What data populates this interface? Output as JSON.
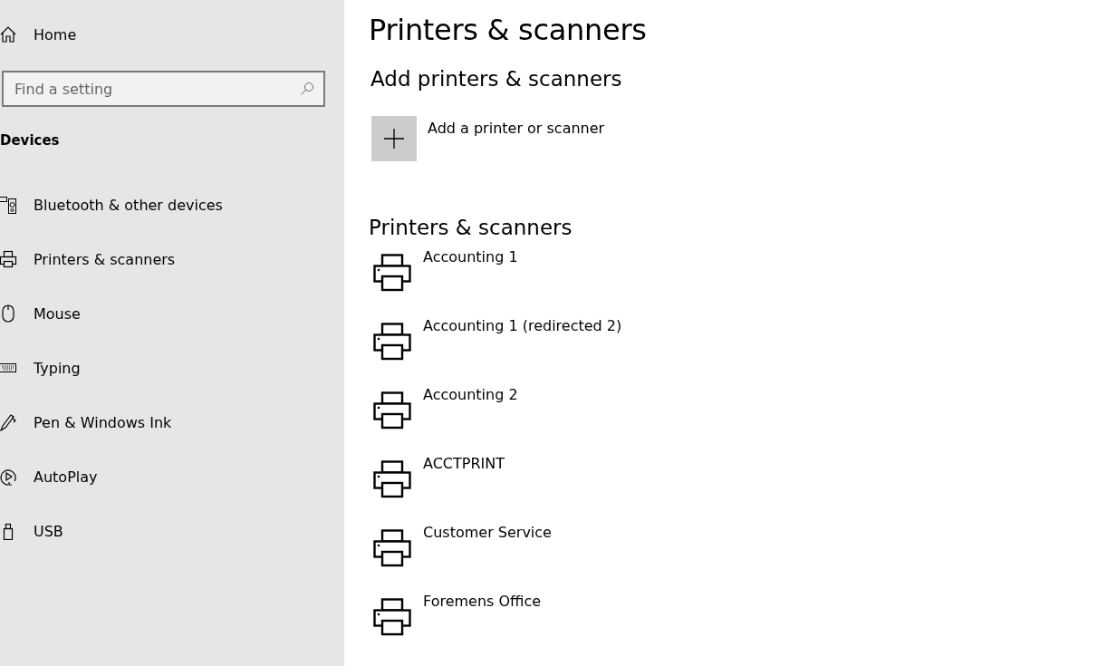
{
  "sidebar": {
    "home": {
      "label": "Home"
    },
    "search": {
      "placeholder": "Find a setting"
    },
    "section_title": "Devices",
    "items": [
      {
        "label": "Bluetooth & other devices",
        "kind": "bluetooth"
      },
      {
        "label": "Printers & scanners",
        "kind": "printer"
      },
      {
        "label": "Mouse",
        "kind": "mouse"
      },
      {
        "label": "Typing",
        "kind": "keyboard"
      },
      {
        "label": "Pen & Windows Ink",
        "kind": "pen"
      },
      {
        "label": "AutoPlay",
        "kind": "autoplay"
      },
      {
        "label": "USB",
        "kind": "usb"
      }
    ]
  },
  "main": {
    "title": "Printers & scanners",
    "add_section": {
      "heading": "Add printers & scanners",
      "add_button": {
        "label": "Add a printer or scanner"
      }
    },
    "list_heading": "Printers & scanners",
    "printers": [
      {
        "name": "Accounting 1"
      },
      {
        "name": "Accounting 1 (redirected 2)"
      },
      {
        "name": "Accounting 2"
      },
      {
        "name": "ACCTPRINT"
      },
      {
        "name": "Customer Service"
      },
      {
        "name": "Foremens Office"
      }
    ]
  }
}
